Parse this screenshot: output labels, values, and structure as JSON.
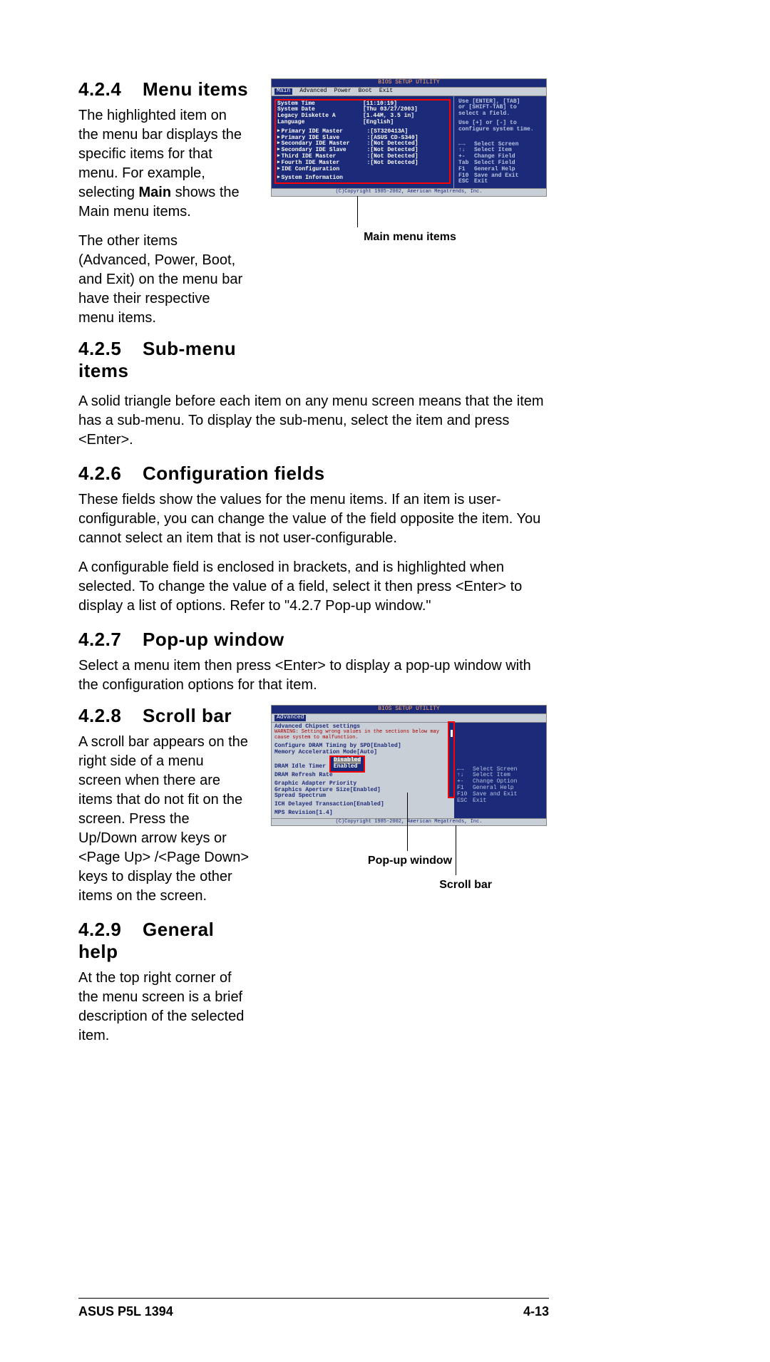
{
  "sections": {
    "s424": {
      "num": "4.2.4",
      "title": "Menu items",
      "p1a": "The highlighted item on the menu bar displays the specific items for that menu. For example, selecting ",
      "p1bold": "Main",
      "p1b": " shows the Main menu items.",
      "p2": "The other items (Advanced, Power, Boot, and Exit) on the menu bar have their respective menu items."
    },
    "s425": {
      "num": "4.2.5",
      "title": "Sub-menu items",
      "p1": "A solid triangle before each item on any menu screen means that the item has a sub-menu. To display the sub-menu, select the item and press <Enter>."
    },
    "s426": {
      "num": "4.2.6",
      "title": "Configuration fields",
      "p1": "These fields show the values for the menu items. If an item is user-configurable, you can change the value of the field opposite the item. You cannot select an item that is not user-configurable.",
      "p2": "A configurable field is enclosed in brackets, and is highlighted when selected. To change the value of a field, select it then press <Enter> to display a list of options. Refer to \"4.2.7 Pop-up window.\""
    },
    "s427": {
      "num": "4.2.7",
      "title": "Pop-up window",
      "p1": "Select a menu item then press <Enter> to display a pop-up window with the configuration options for that item."
    },
    "s428": {
      "num": "4.2.8",
      "title": "Scroll bar",
      "p1": "A scroll bar appears on the right side of a menu screen when there are items that do not fit on the screen. Press the Up/Down arrow keys or <Page Up> /<Page Down> keys to display the other items on the screen."
    },
    "s429": {
      "num": "4.2.9",
      "title": "General help",
      "p1": "At the top right corner of the menu screen is a brief description of the selected item."
    }
  },
  "bios1": {
    "title": "BIOS SETUP UTILITY",
    "tabs": [
      "Main",
      "Advanced",
      "Power",
      "Boot",
      "Exit"
    ],
    "rows": [
      {
        "lbl": "System Time",
        "val": "[11:10:19]"
      },
      {
        "lbl": "System Date",
        "val": "[Thu 03/27/2003]"
      },
      {
        "lbl": "Legacy Diskette A",
        "val": "[1.44M, 3.5 in]"
      },
      {
        "lbl": "Language",
        "val": "[English]"
      }
    ],
    "devrows": [
      {
        "lbl": "Primary IDE Master",
        "val": ":[ST320413A]"
      },
      {
        "lbl": "Primary IDE Slave",
        "val": ":[ASUS CD-S340]"
      },
      {
        "lbl": "Secondary IDE Master",
        "val": ":[Not Detected]"
      },
      {
        "lbl": "Secondary IDE Slave",
        "val": ":[Not Detected]"
      },
      {
        "lbl": "Third IDE Master",
        "val": ":[Not Detected]"
      },
      {
        "lbl": "Fourth IDE Master",
        "val": ":[Not Detected]"
      },
      {
        "lbl": "IDE Configuration",
        "val": ""
      }
    ],
    "sysinfo": "System Information",
    "help1": "Use [ENTER], [TAB]",
    "help2": "or [SHIFT-TAB] to",
    "help3": "select a field.",
    "help4": "Use [+] or [-] to",
    "help5": "configure system time.",
    "nav": [
      {
        "k": "←→",
        "v": "Select Screen"
      },
      {
        "k": "↑↓",
        "v": "Select Item"
      },
      {
        "k": "+-",
        "v": "Change Field"
      },
      {
        "k": "Tab",
        "v": "Select Field"
      },
      {
        "k": "F1",
        "v": "General Help"
      },
      {
        "k": "F10",
        "v": "Save and Exit"
      },
      {
        "k": "ESC",
        "v": "Exit"
      }
    ],
    "foot": "(C)Copyright 1985-2002, American Megatrends, Inc.",
    "caption": "Main menu items"
  },
  "bios2": {
    "title": "BIOS SETUP UTILITY",
    "tab": "Advanced",
    "subtitle": "Advanced Chipset settings",
    "warn": "WARNING: Setting wrong values in the sections below may cause system to malfunction.",
    "rows": [
      {
        "lbl": "Configure DRAM Timing by SPD",
        "val": "[Enabled]"
      },
      {
        "lbl": "Memory Acceleration Mode",
        "val": "[Auto]"
      },
      {
        "lbl": "DRAM Idle Timer",
        "val": ""
      },
      {
        "lbl": "DRAM Refresh Rate",
        "val": ""
      }
    ],
    "popup": [
      "Disabled",
      "Enabled"
    ],
    "rows2": [
      {
        "lbl": "Graphic Adapter Priority",
        "val": ""
      },
      {
        "lbl": "Graphics Aperture Size",
        "val": "[Enabled]"
      },
      {
        "lbl": "Spread Spectrum",
        "val": ""
      }
    ],
    "rows3": [
      {
        "lbl": "ICH Delayed Transaction",
        "val": "[Enabled]"
      }
    ],
    "rows4": [
      {
        "lbl": "MPS Revision",
        "val": "[1.4]"
      }
    ],
    "nav": [
      {
        "k": "←→",
        "v": "Select Screen"
      },
      {
        "k": "↑↓",
        "v": "Select Item"
      },
      {
        "k": "+-",
        "v": "Change Option"
      },
      {
        "k": "F1",
        "v": "General Help"
      },
      {
        "k": "F10",
        "v": "Save and Exit"
      },
      {
        "k": "ESC",
        "v": "Exit"
      }
    ],
    "caption_popup": "Pop-up window",
    "caption_scroll": "Scroll bar"
  },
  "footer": {
    "left": "ASUS P5L 1394",
    "right": "4-13"
  }
}
